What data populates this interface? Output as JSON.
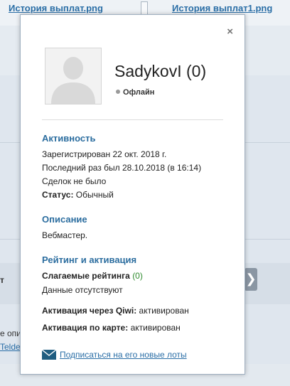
{
  "background": {
    "links": [
      "История выплат.png",
      "История выплат1.png"
    ],
    "side_text_1": "т",
    "side_text_2": "е опи",
    "side_link": "Telde",
    "arrow_glyph": "❯"
  },
  "modal": {
    "close_glyph": "×",
    "username": "SadykovI (0)",
    "status": "Офлайн",
    "activity": {
      "heading": "Активность",
      "registered": "Зарегистрирован 22 окт. 2018 г.",
      "last_seen": "Последний раз был 28.10.2018 (в 16:14)",
      "deals": "Сделок не было",
      "status_label": "Статус:",
      "status_value": "Обычный"
    },
    "description": {
      "heading": "Описание",
      "text": "Вебмастер."
    },
    "rating": {
      "heading": "Рейтинг и активация",
      "components_label": "Слагаемые рейтинга",
      "components_count": "(0)",
      "no_data": "Данные отсутствуют",
      "qiwi_label": "Активация через Qiwi:",
      "qiwi_value": "активирован",
      "card_label": "Активация по карте:",
      "card_value": "активирован"
    },
    "subscribe_link": "Подписаться на его новые лоты"
  },
  "colors": {
    "accent": "#2b6d9f",
    "link": "#2a6ea6",
    "positive": "#2e8b2e"
  }
}
